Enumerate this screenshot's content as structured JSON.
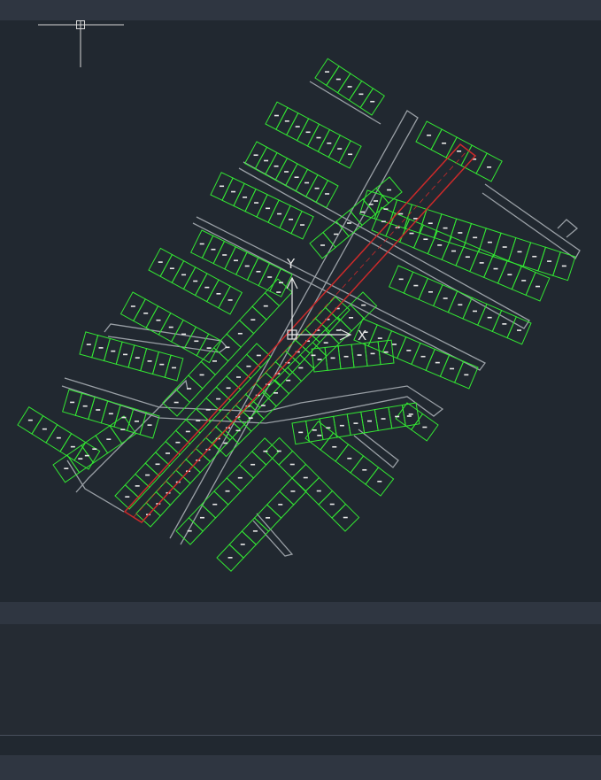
{
  "ucs": {
    "x_label": "X",
    "y_label": "Y"
  },
  "colors": {
    "lot_outline": "#33e633",
    "road_outline": "#9aa0a6",
    "highlight_road": "#cc2a2a",
    "background": "#212830",
    "panel": "#2f3641"
  },
  "command_line": {
    "history": "",
    "prompt": ""
  }
}
